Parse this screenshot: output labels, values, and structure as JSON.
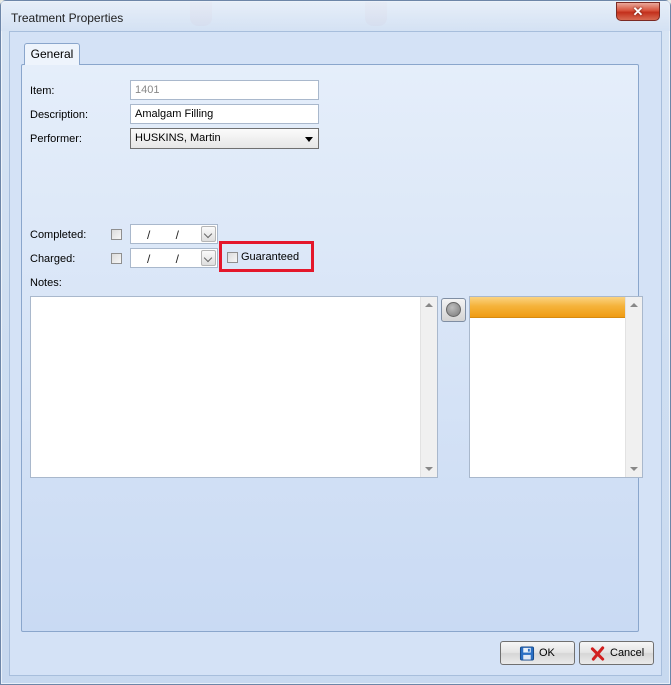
{
  "window": {
    "title": "Treatment Properties",
    "close_glyph": "✕"
  },
  "tabs": [
    {
      "label": "General"
    }
  ],
  "form": {
    "item_label": "Item:",
    "item_value": "1401",
    "description_label": "Description:",
    "description_value": "Amalgam Filling",
    "performer_label": "Performer:",
    "performer_value": "HUSKINS, Martin",
    "completed_label": "Completed:",
    "completed_date": "/ /",
    "charged_label": "Charged:",
    "charged_date": "/ /",
    "guaranteed_label": "Guaranteed",
    "notes_label": "Notes:"
  },
  "buttons": {
    "ok_label": "OK",
    "cancel_label": "Cancel"
  },
  "colors": {
    "highlight": "#e4172b",
    "list_header": "#f5b33b",
    "save_icon": "#2a6fc4",
    "cancel_icon": "#d11f1f"
  },
  "icons": {
    "ok": "save-icon",
    "cancel": "red-x-icon",
    "round_button": "circle-icon"
  }
}
